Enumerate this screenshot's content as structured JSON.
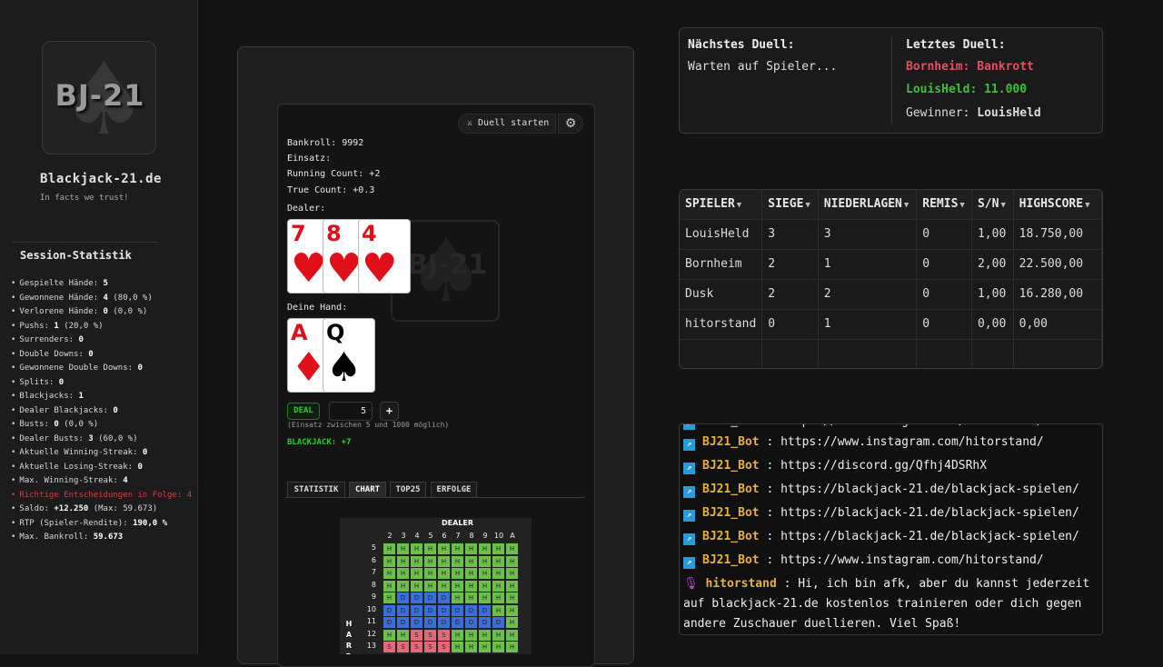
{
  "sidebar": {
    "logo_text": "BJ-21",
    "site_title": "Blackjack-21.de",
    "tagline": "In facts we trust!",
    "session_title": "Session-Statistik",
    "stats": [
      {
        "label": "Gespielte Hände:",
        "value": "5"
      },
      {
        "label": "Gewonnene Hände:",
        "value": "4",
        "extra": "(80,0 %)"
      },
      {
        "label": "Verlorene Hände:",
        "value": "0",
        "extra": "(0,0 %)"
      },
      {
        "label": "Pushs:",
        "value": "1",
        "extra": "(20,0 %)"
      },
      {
        "label": "Surrenders:",
        "value": "0"
      },
      {
        "label": "Double Downs:",
        "value": "0"
      },
      {
        "label": "Gewonnene Double Downs:",
        "value": "0"
      },
      {
        "label": "Splits:",
        "value": "0"
      },
      {
        "label": "Blackjacks:",
        "value": "1"
      },
      {
        "label": "Dealer Blackjacks:",
        "value": "0"
      },
      {
        "label": "Busts:",
        "value": "0",
        "extra": "(0,0 %)"
      },
      {
        "label": "Dealer Busts:",
        "value": "3",
        "extra": "(60,0 %)"
      },
      {
        "label": "Aktuelle Winning-Streak:",
        "value": "0"
      },
      {
        "label": "Aktuelle Losing-Streak:",
        "value": "0"
      },
      {
        "label": "Max. Winning-Streak:",
        "value": "4"
      },
      {
        "label": "Richtige Entscheidungen in Folge: 4",
        "value": "",
        "warn": true
      },
      {
        "label": "Saldo:",
        "value": "+12.250",
        "extra": "(Max: 59.673)"
      },
      {
        "label": "RTP (Spieler-Rendite):",
        "value": "190,0 %"
      },
      {
        "label": "Max. Bankroll:",
        "value": "59.673"
      }
    ]
  },
  "game": {
    "duel_button": "⚔ Duell starten",
    "bankroll": "Bankroll: 9992",
    "einsatz": "Einsatz:",
    "running_count": "Running Count: +2",
    "true_count": "True Count: +0.3",
    "dealer_label": "Dealer:",
    "player_label": "Deine Hand:",
    "deal_label": "DEAL",
    "bet_value": "5",
    "plus_label": "+",
    "bet_hint": "(Einsatz zwischen 5 und 1000 möglich)",
    "result": "BLACKJACK: +7",
    "tabs": [
      "STATISTIK",
      "CHART",
      "TOP25",
      "ERFOLGE"
    ],
    "active_tab": "CHART",
    "dealer_cards": [
      {
        "rank": "7",
        "suit": "♥",
        "color": "#e0101a"
      },
      {
        "rank": "8",
        "suit": "♥",
        "color": "#e0101a"
      },
      {
        "rank": "4",
        "suit": "♥",
        "color": "#e0101a"
      }
    ],
    "player_cards": [
      {
        "rank": "A",
        "suit": "♦",
        "color": "#e0101a"
      },
      {
        "rank": "Q",
        "suit": "♠",
        "color": "#000000"
      }
    ]
  },
  "strategy_chart": {
    "title": "DEALER",
    "side_label": "HARD",
    "columns": [
      "2",
      "3",
      "4",
      "5",
      "6",
      "7",
      "8",
      "9",
      "10",
      "A"
    ],
    "rows": [
      {
        "label": "5",
        "cells": [
          "H",
          "H",
          "H",
          "H",
          "H",
          "H",
          "H",
          "H",
          "H",
          "H"
        ]
      },
      {
        "label": "6",
        "cells": [
          "H",
          "H",
          "H",
          "H",
          "H",
          "H",
          "H",
          "H",
          "H",
          "H"
        ]
      },
      {
        "label": "7",
        "cells": [
          "H",
          "H",
          "H",
          "H",
          "H",
          "H",
          "H",
          "H",
          "H",
          "H"
        ]
      },
      {
        "label": "8",
        "cells": [
          "H",
          "H",
          "H",
          "H",
          "H",
          "H",
          "H",
          "H",
          "H",
          "H"
        ]
      },
      {
        "label": "9",
        "cells": [
          "H",
          "D",
          "D",
          "D",
          "D",
          "H",
          "H",
          "H",
          "H",
          "H"
        ]
      },
      {
        "label": "10",
        "cells": [
          "D",
          "D",
          "D",
          "D",
          "D",
          "D",
          "D",
          "D",
          "H",
          "H"
        ]
      },
      {
        "label": "11",
        "cells": [
          "D",
          "D",
          "D",
          "D",
          "D",
          "D",
          "D",
          "D",
          "D",
          "H"
        ]
      },
      {
        "label": "12",
        "cells": [
          "H",
          "H",
          "S",
          "S",
          "S",
          "H",
          "H",
          "H",
          "H",
          "H"
        ]
      },
      {
        "label": "13",
        "cells": [
          "S",
          "S",
          "S",
          "S",
          "S",
          "H",
          "H",
          "H",
          "H",
          "H"
        ]
      }
    ]
  },
  "duel": {
    "next_title": "Nächstes Duell:",
    "next_status": "Warten auf Spieler...",
    "last_title": "Letztes Duell:",
    "last_line1": "Bornheim: Bankrott",
    "last_line1_color": "#e05060",
    "last_line2": "LouisHeld: 11.000",
    "last_line2_color": "#3ac23a",
    "winner_label": "Gewinner:",
    "winner_name": "LouisHeld"
  },
  "scoreboard": {
    "headers": [
      "SPIELER",
      "SIEGE",
      "NIEDERLAGEN",
      "REMIS",
      "S/N",
      "HIGHSCORE"
    ],
    "rows": [
      [
        "LouisHeld",
        "3",
        "3",
        "0",
        "1,00",
        "18.750,00"
      ],
      [
        "Bornheim",
        "2",
        "1",
        "0",
        "2,00",
        "22.500,00"
      ],
      [
        "Dusk",
        "2",
        "2",
        "0",
        "1,00",
        "16.280,00"
      ],
      [
        "hitorstand",
        "0",
        "1",
        "0",
        "0,00",
        "0,00"
      ]
    ]
  },
  "chat": {
    "messages": [
      {
        "user": "BJ21_Bot",
        "text": ": https://www.instagram.com/hitorstand/"
      },
      {
        "user": "BJ21_Bot",
        "text": ": https://discord.gg/Qfhj4DSRhX"
      },
      {
        "user": "BJ21_Bot",
        "text": ": https://blackjack-21.de/blackjack-spielen/"
      },
      {
        "user": "BJ21_Bot",
        "text": ": https://blackjack-21.de/blackjack-spielen/"
      },
      {
        "user": "BJ21_Bot",
        "text": ": https://blackjack-21.de/blackjack-spielen/"
      },
      {
        "user": "BJ21_Bot",
        "text": ": https://www.instagram.com/hitorstand/"
      }
    ],
    "last_user": "hitorstand",
    "last_text_1": ": Hi, ich bin afk, aber du kannst jederzeit",
    "last_text_2": "auf blackjack-21.de kostenlos trainieren oder dich gegen",
    "last_text_3": "andere Zuschauer duellieren. Viel Spaß!"
  }
}
